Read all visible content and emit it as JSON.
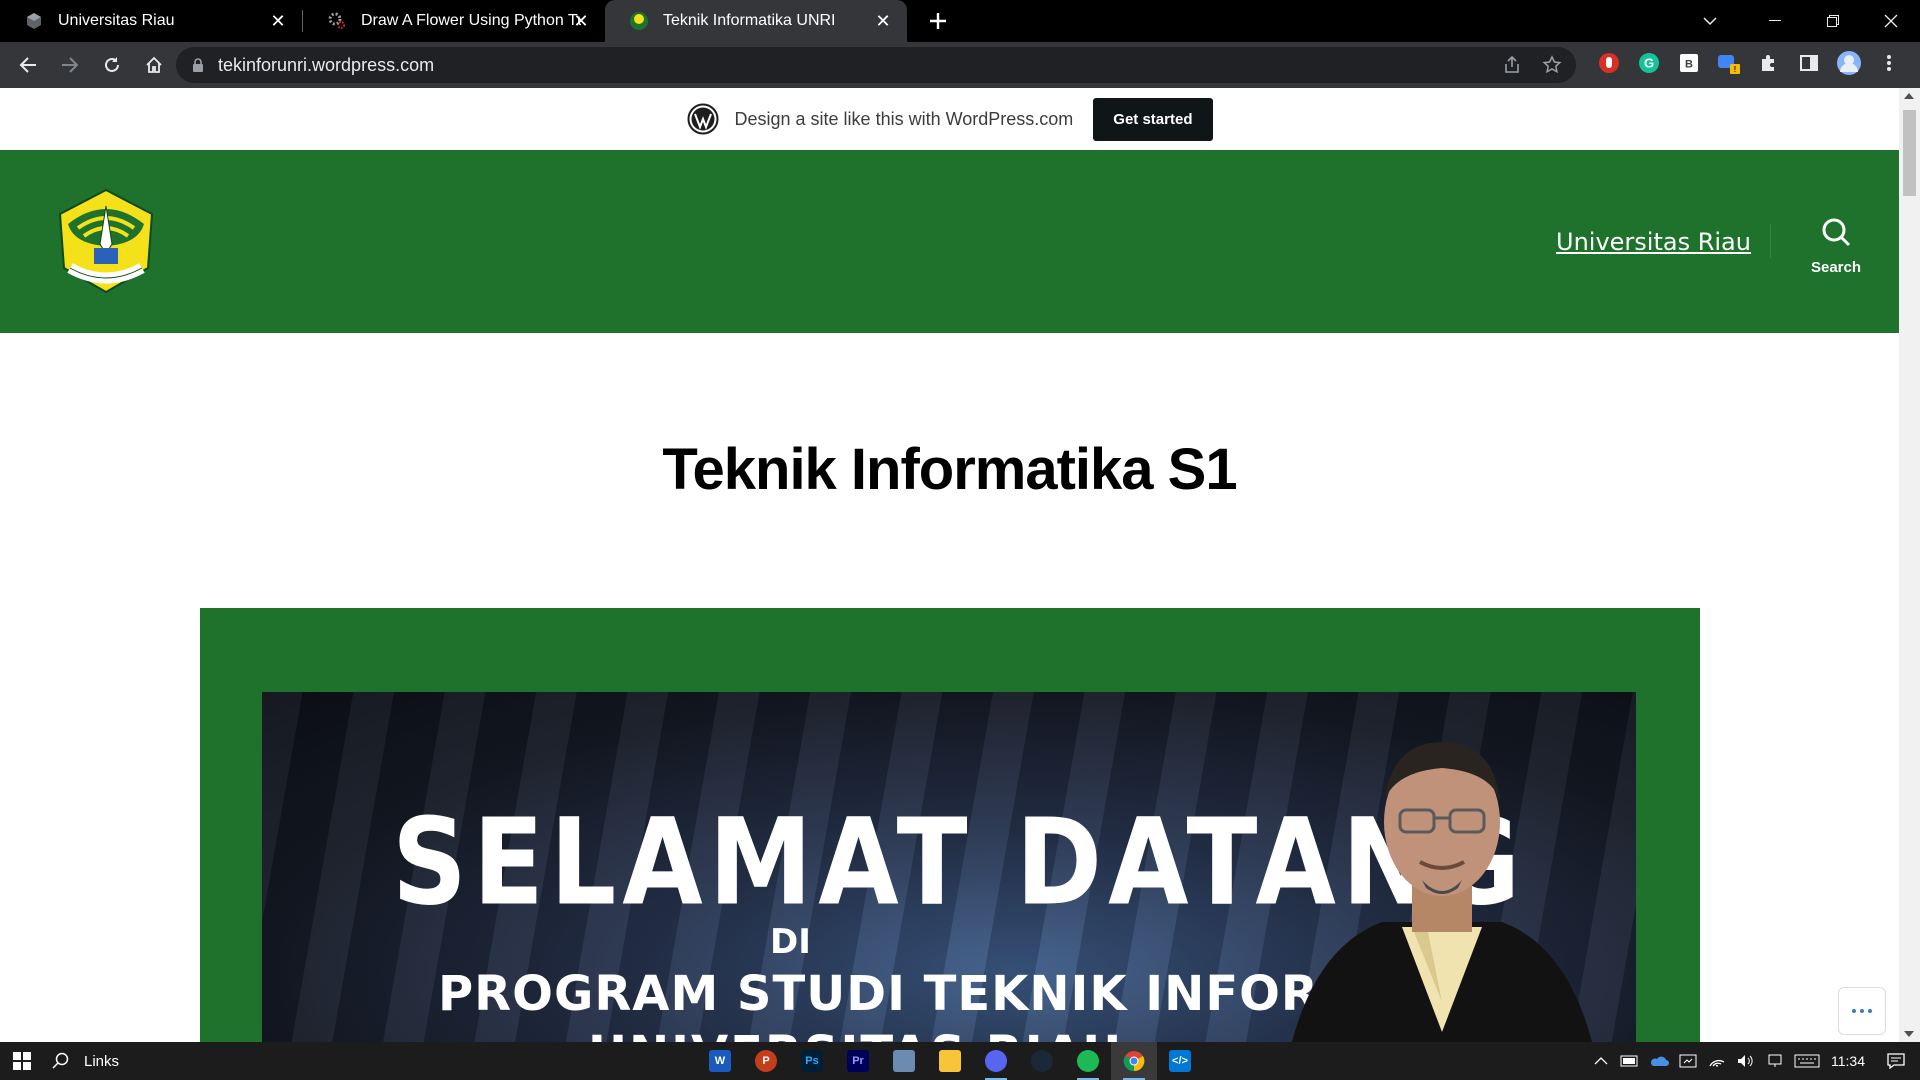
{
  "browser": {
    "tabs": [
      {
        "title": "Universitas Riau",
        "favicon": "cube-icon",
        "active": false
      },
      {
        "title": "Draw A Flower Using Python Turtle",
        "favicon": "gears-icon",
        "active": false
      },
      {
        "title": "Teknik Informatika UNRI",
        "favicon": "unri-logo-icon",
        "active": true
      }
    ],
    "address": "tekinforunri.wordpress.com"
  },
  "wp_banner": {
    "text": "Design a site like this with WordPress.com",
    "cta": "Get started"
  },
  "site": {
    "header_color": "#1e722b",
    "nav_link": "Universitas Riau",
    "search_label": "Search",
    "logo_text": "UNIVERSITAS RIAU"
  },
  "page": {
    "title": "Teknik Informatika S1",
    "banner": {
      "line1": "SELAMAT DATANG",
      "line2": "DI",
      "line3": "PROGRAM STUDI TEKNIK INFORMATIKA",
      "line4": "UNIVERSITAS RIAU"
    }
  },
  "taskbar": {
    "search_text": "Links",
    "apps": [
      "word",
      "powerpoint",
      "photoshop",
      "premiere",
      "photos",
      "file-explorer",
      "discord",
      "steam",
      "spotify",
      "chrome",
      "vscode"
    ],
    "clock": "11:34"
  }
}
